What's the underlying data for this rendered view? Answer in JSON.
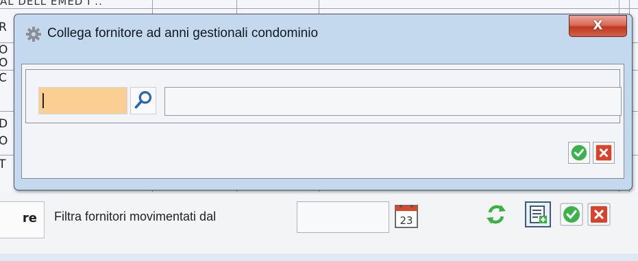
{
  "background": {
    "top_text": "AL DELL EMED I ..",
    "row_fragments": [
      "R",
      "O",
      "O",
      "C",
      "D",
      "O",
      "T"
    ],
    "toolbar": {
      "left_box_text": "re",
      "filter_label": "Filtra fornitori movimentati dal",
      "date_value": "",
      "calendar_day": "23"
    }
  },
  "dialog": {
    "title": "Collega fornitore ad anni gestionali condominio",
    "close_label": "X",
    "code_value": "",
    "description_value": ""
  },
  "colors": {
    "dialog_frame": "#c5d9ee",
    "input_highlight": "#fbcf94",
    "ok_green": "#3bb34a",
    "cancel_red": "#d9422b",
    "refresh_green": "#3cb043"
  },
  "icons": {
    "title": "gear-icon",
    "search": "magnifier-icon",
    "ok": "check-icon",
    "cancel": "x-icon",
    "calendar": "calendar-icon",
    "refresh": "refresh-icon",
    "add": "table-add-icon"
  }
}
